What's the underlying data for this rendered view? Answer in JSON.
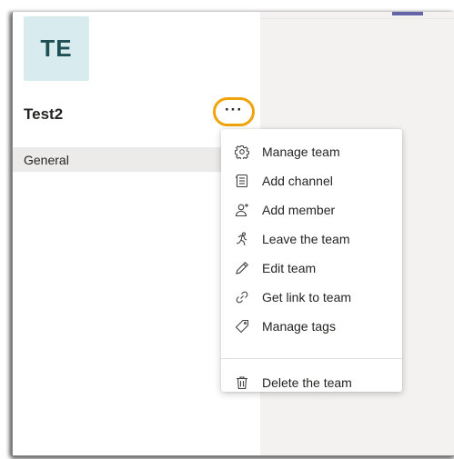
{
  "team": {
    "avatar_initials": "TE",
    "name": "Test2",
    "more_options_label": "···"
  },
  "channels": [
    {
      "label": "General"
    }
  ],
  "menu": {
    "items": [
      {
        "label": "Manage team",
        "icon": "gear-icon"
      },
      {
        "label": "Add channel",
        "icon": "channel-list-icon"
      },
      {
        "label": "Add member",
        "icon": "add-person-icon"
      },
      {
        "label": "Leave the team",
        "icon": "running-person-icon"
      },
      {
        "label": "Edit team",
        "icon": "pencil-icon"
      },
      {
        "label": "Get link to team",
        "icon": "link-icon"
      },
      {
        "label": "Manage tags",
        "icon": "tag-icon"
      }
    ],
    "footer_items": [
      {
        "label": "Delete the team",
        "icon": "trash-icon"
      }
    ]
  },
  "colors": {
    "accent": "#6264a7",
    "highlight_ring": "#f0a30a",
    "avatar_bg": "#d8ecef",
    "avatar_text": "#1d4f55",
    "selected_channel_bg": "#edebe9",
    "right_pane_bg": "#f3f2f1"
  }
}
